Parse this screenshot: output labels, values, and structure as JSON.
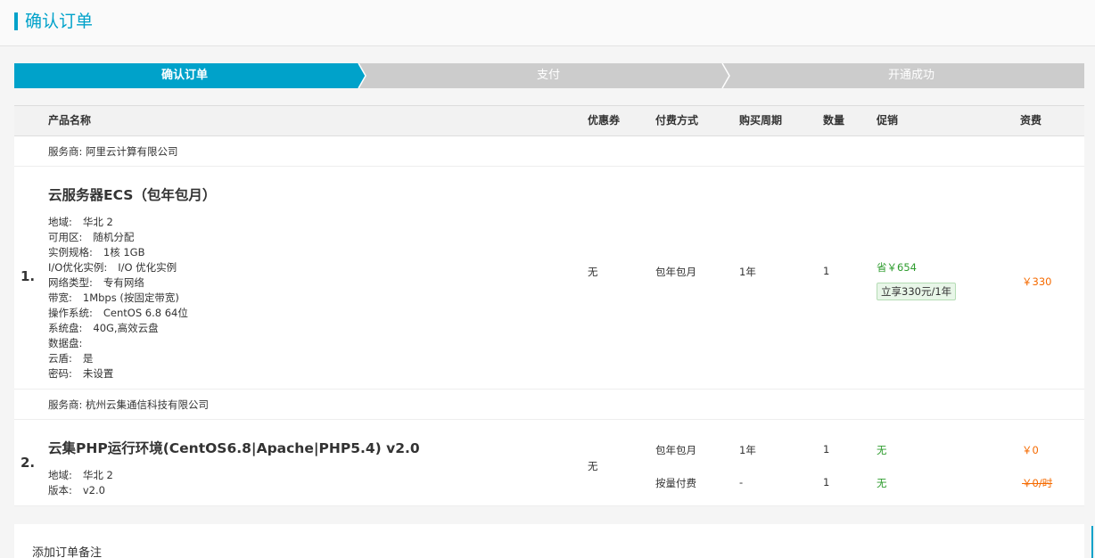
{
  "header": {
    "title": "确认订单"
  },
  "steps": [
    "确认订单",
    "支付",
    "开通成功"
  ],
  "colors": {
    "accent": "#00a2ca",
    "step_inactive": "#cccccc",
    "green": "#2e9c2e",
    "orange": "#f56a00"
  },
  "table": {
    "columns": [
      "产品名称",
      "优惠券",
      "付费方式",
      "购买周期",
      "数量",
      "促销",
      "资费"
    ]
  },
  "orders": [
    {
      "vendor": "服务商: 阿里云计算有限公司",
      "index": "1.",
      "name": "云服务器ECS（包年包月）",
      "specs": [
        {
          "k": "地域:",
          "v": "华北 2"
        },
        {
          "k": "可用区:",
          "v": "随机分配"
        },
        {
          "k": "实例规格:",
          "v": "1核 1GB"
        },
        {
          "k": "I/O优化实例:",
          "v": "I/O 优化实例"
        },
        {
          "k": "网络类型:",
          "v": "专有网络"
        },
        {
          "k": "带宽:",
          "v": "1Mbps (按固定带宽)"
        },
        {
          "k": "操作系统:",
          "v": "CentOS 6.8 64位"
        },
        {
          "k": "系统盘:",
          "v": "40G,高效云盘"
        },
        {
          "k": "数据盘:",
          "v": ""
        },
        {
          "k": "云盾:",
          "v": "是"
        },
        {
          "k": "密码:",
          "v": "未设置"
        }
      ],
      "coupon": "无",
      "billing": "包年包月",
      "period": "1年",
      "qty": "1",
      "promo_save": "省￥654",
      "promo_tag": "立享330元/1年",
      "price": "￥330"
    },
    {
      "vendor": "服务商: 杭州云集通信科技有限公司",
      "index": "2.",
      "name": "云集PHP运行环境(CentOS6.8|Apache|PHP5.4) v2.0",
      "specs": [
        {
          "k": "地域:",
          "v": "华北 2"
        },
        {
          "k": "版本:",
          "v": "v2.0"
        }
      ],
      "coupon": "无",
      "lines": [
        {
          "billing": "包年包月",
          "period": "1年",
          "qty": "1",
          "promo": "无",
          "price": "￥0"
        },
        {
          "billing": "按量付费",
          "period": "-",
          "qty": "1",
          "promo": "无",
          "price": "￥0/时"
        }
      ]
    }
  ],
  "remark": {
    "label": "添加订单备注"
  }
}
